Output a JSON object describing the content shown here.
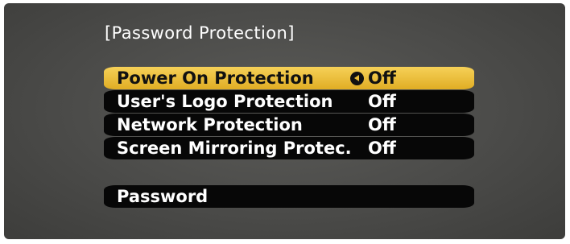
{
  "menu": {
    "title": "[Password Protection]",
    "items": [
      {
        "label": "Power On Protection",
        "value": "Off",
        "selected": true
      },
      {
        "label": "User's Logo Protection",
        "value": "Off"
      },
      {
        "label": "Network Protection",
        "value": "Off"
      },
      {
        "label": "Screen Mirroring Protec.",
        "value": "Off"
      }
    ],
    "password_label": "Password"
  },
  "colors": {
    "highlight": "#EBBE3A",
    "row_background": "#070707",
    "screen_background": "#4B4B49",
    "text": "#FFFFFF"
  },
  "icons": {
    "selection_cursor": "left-arrow-circle-icon"
  }
}
